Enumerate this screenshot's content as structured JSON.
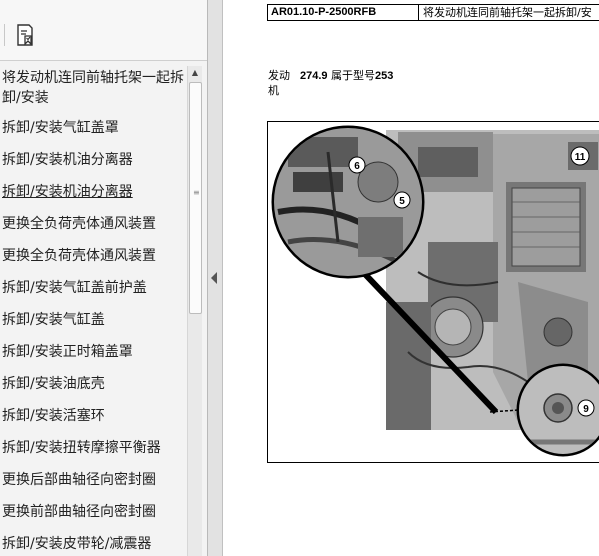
{
  "nav": {
    "toolbar": {
      "bookmark_icon": "bookmark-icon"
    },
    "items": [
      "将发动机连同前轴托架一起拆卸/安装",
      "拆卸/安装气缸盖罩",
      "拆卸/安装机油分离器",
      "拆卸/安装机油分离器",
      "更换全负荷壳体通风装置",
      "更换全负荷壳体通风装置",
      "拆卸/安装气缸盖前护盖",
      "拆卸/安装气缸盖",
      "拆卸/安装正时箱盖罩",
      "拆卸/安装油底壳",
      "拆卸/安装活塞环",
      "拆卸/安装扭转摩擦平衡器",
      "更换后部曲轴径向密封圈",
      "更换前部曲轴径向密封圈",
      "拆卸/安装皮带轮/减震器"
    ]
  },
  "doc": {
    "code": "AR01.10-P-2500RFB",
    "description": "将发动机连同前轴托架一起拆卸/安",
    "engine_label": "发动机",
    "engine_number": "274.9",
    "engine_belongs": "属于型号",
    "engine_model": "253"
  },
  "figure": {
    "callouts": [
      "6",
      "5",
      "11",
      "9"
    ]
  }
}
